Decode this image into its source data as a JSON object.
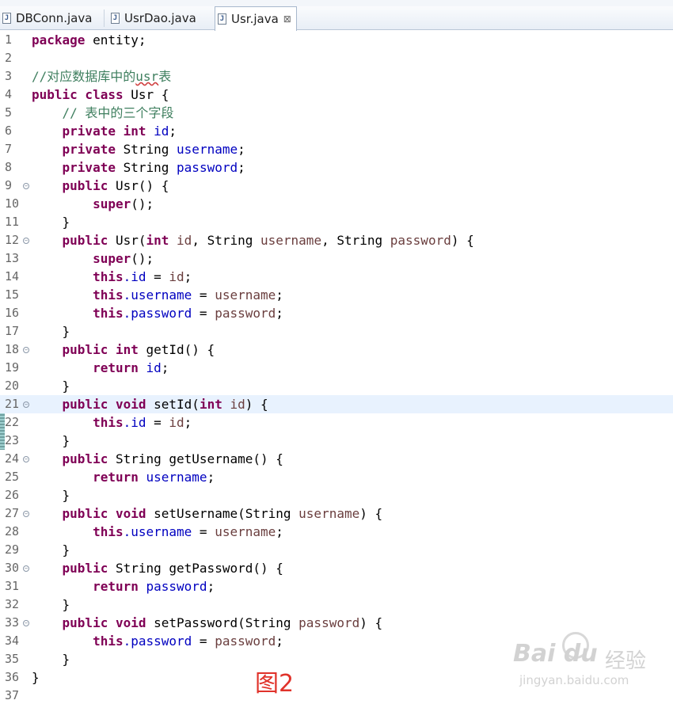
{
  "tabs": [
    {
      "label": "DBConn.java"
    },
    {
      "label": "UsrDao.java"
    },
    {
      "label": "Usr.java",
      "close": "⊠"
    }
  ],
  "line_numbers": [
    "1",
    "2",
    "3",
    "4",
    "5",
    "6",
    "7",
    "8",
    "9",
    "10",
    "11",
    "12",
    "13",
    "14",
    "15",
    "16",
    "17",
    "18",
    "19",
    "20",
    "21",
    "22",
    "23",
    "24",
    "25",
    "26",
    "27",
    "28",
    "29",
    "30",
    "31",
    "32",
    "33",
    "34",
    "35",
    "36",
    "37"
  ],
  "code": {
    "l1_kw": "package",
    "l1_rest": " entity;",
    "l3_a": "//对应数据库中的",
    "l3_u": "usr",
    "l3_b": "表",
    "l4_kw": "public class",
    "l4_rest": " Usr {",
    "l5": "    // 表中的三个字段",
    "l6_kw": "    private int",
    "l6_f": " id",
    "l6_e": ";",
    "l7_kw": "    private",
    "l7_t": " String",
    "l7_f": " username",
    "l7_e": ";",
    "l8_kw": "    private",
    "l8_t": " String",
    "l8_f": " password",
    "l8_e": ";",
    "l9_kw": "    public",
    "l9_rest": " Usr() {",
    "l10_kw": "        super",
    "l10_rest": "();",
    "l11": "    }",
    "l12_kw": "    public",
    "l12_a": " Usr(",
    "l12_kw2": "int",
    "l12_p1": " id",
    "l12_b": ", String",
    "l12_p2": " username",
    "l12_c": ", String",
    "l12_p3": " password",
    "l12_d": ") {",
    "l13_kw": "        super",
    "l13_rest": "();",
    "l14_kw": "        this",
    "l14_f": ".id",
    "l14_a": " = ",
    "l14_p": "id",
    "l14_e": ";",
    "l15_kw": "        this",
    "l15_f": ".username",
    "l15_a": " = ",
    "l15_p": "username",
    "l15_e": ";",
    "l16_kw": "        this",
    "l16_f": ".password",
    "l16_a": " = ",
    "l16_p": "password",
    "l16_e": ";",
    "l17": "    }",
    "l18_kw": "    public int",
    "l18_rest": " getId() {",
    "l19_kw": "        return",
    "l19_f": " id",
    "l19_e": ";",
    "l20": "    }",
    "l21_kw": "    public void",
    "l21_a": " setId(",
    "l21_kw2": "int",
    "l21_p": " id",
    "l21_b": ") {",
    "l22_kw": "        this",
    "l22_f": ".id",
    "l22_a": " = ",
    "l22_p": "id",
    "l22_e": ";",
    "l23": "    }",
    "l24_kw": "    public",
    "l24_rest": " String getUsername() {",
    "l25_kw": "        return",
    "l25_f": " username",
    "l25_e": ";",
    "l26": "    }",
    "l27_kw": "    public void",
    "l27_a": " setUsername(String",
    "l27_p": " username",
    "l27_b": ") {",
    "l28_kw": "        this",
    "l28_f": ".username",
    "l28_a": " = ",
    "l28_p": "username",
    "l28_e": ";",
    "l29": "    }",
    "l30_kw": "    public",
    "l30_rest": " String getPassword() {",
    "l31_kw": "        return",
    "l31_f": " password",
    "l31_e": ";",
    "l32": "    }",
    "l33_kw": "    public void",
    "l33_a": " setPassword(String",
    "l33_p": " password",
    "l33_b": ") {",
    "l34_kw": "        this",
    "l34_f": ".password",
    "l34_a": " = ",
    "l34_p": "password",
    "l34_e": ";",
    "l35": "    }",
    "l36": "}"
  },
  "fold_marker": "−",
  "caption": "图2",
  "watermark": {
    "logo": "Bai du",
    "cn": "经验",
    "url": "jingyan.baidu.com"
  },
  "colors": {
    "keyword": "#7f0055",
    "field": "#0000c0",
    "parameter": "#6a3e3e",
    "comment": "#3f7f5f",
    "current_line": "#e8f2fe",
    "caption": "#e0322a"
  }
}
